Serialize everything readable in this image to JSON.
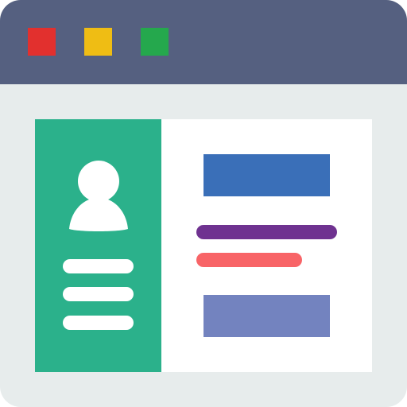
{
  "window": {
    "background_color": "#e7ecec",
    "titlebar_color": "#556080",
    "controls": [
      {
        "name": "close",
        "color": "#e2302e"
      },
      {
        "name": "minimize",
        "color": "#efbd14"
      },
      {
        "name": "maximize",
        "color": "#25a84d"
      }
    ]
  },
  "card": {
    "background_color": "#ffffff",
    "profile_panel": {
      "color": "#2bb18b",
      "avatar_icon": "user-avatar-icon",
      "avatar_color": "#ffffff",
      "text_lines": 3
    },
    "content_panel": {
      "block_top_color": "#3a6fb8",
      "bar_long_color": "#6f3290",
      "bar_short_color": "#f86467",
      "block_bottom_color": "#7383bf"
    }
  }
}
